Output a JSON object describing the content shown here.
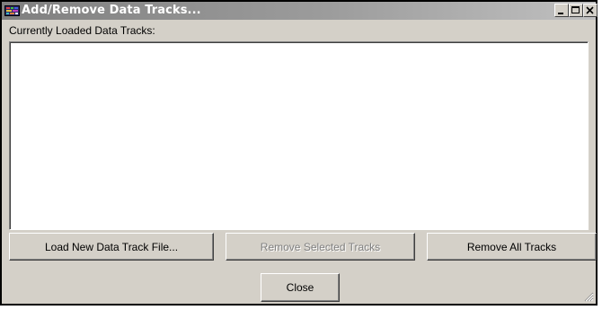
{
  "window": {
    "title": "Add/Remove Data Tracks...",
    "controls": {
      "minimize": "minimize",
      "maximize": "maximize",
      "close": "close"
    }
  },
  "list": {
    "label": "Currently Loaded Data Tracks:",
    "items": []
  },
  "buttons": {
    "load": "Load New Data Track File...",
    "remove_selected": "Remove Selected Tracks",
    "remove_all": "Remove All Tracks",
    "close": "Close"
  },
  "colors": {
    "face": "#d4d0c8",
    "title_gradient_start": "#808080",
    "title_gradient_end": "#c0c0c0",
    "disabled_text": "#808080"
  },
  "icons": {
    "app": "data-tracks-app-icon",
    "minimize": "minimize-icon",
    "maximize": "maximize-icon",
    "close": "close-icon",
    "resize": "resize-grip-icon"
  }
}
